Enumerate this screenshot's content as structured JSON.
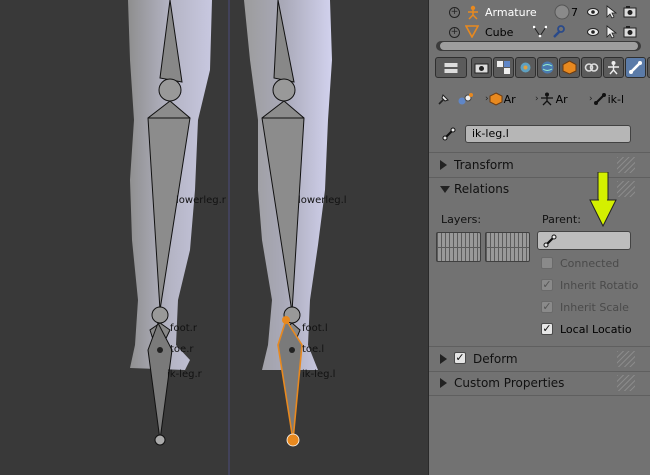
{
  "viewport": {
    "bones": [
      {
        "label": "lowerleg.r"
      },
      {
        "label": "lowerleg.l"
      },
      {
        "label": "foot.r"
      },
      {
        "label": "toe.r"
      },
      {
        "label": "ik-leg.r"
      },
      {
        "label": "foot.l"
      },
      {
        "label": "toe.l"
      },
      {
        "label": "ik-leg.l"
      }
    ],
    "selected_color": "#e8891f"
  },
  "outliner": {
    "rows": [
      {
        "name": "Armature",
        "badge": "7",
        "icon": "armature-icon"
      },
      {
        "name": "Cube",
        "icon": "mesh-icon"
      }
    ]
  },
  "properties": {
    "breadcrumbs": [
      {
        "icon": "cube-icon",
        "text": "Ar"
      },
      {
        "icon": "armature-icon",
        "text": "Ar"
      },
      {
        "icon": "bone-icon",
        "text": "ik-l"
      }
    ],
    "bone_name": "ik-leg.l",
    "sections": {
      "transform": "Transform",
      "relations": "Relations",
      "deform": "Deform",
      "custom": "Custom Properties"
    },
    "relations": {
      "layers_label": "Layers:",
      "parent_label": "Parent:",
      "parent_value": "",
      "checks": [
        {
          "label": "Connected",
          "checked": false,
          "enabled": false
        },
        {
          "label": "Inherit Rotatio",
          "checked": true,
          "enabled": false
        },
        {
          "label": "Inherit Scale",
          "checked": true,
          "enabled": false
        },
        {
          "label": "Local Locatio",
          "checked": true,
          "enabled": true
        }
      ]
    },
    "deform_checked": true,
    "arrow_color": "#d4f000"
  }
}
